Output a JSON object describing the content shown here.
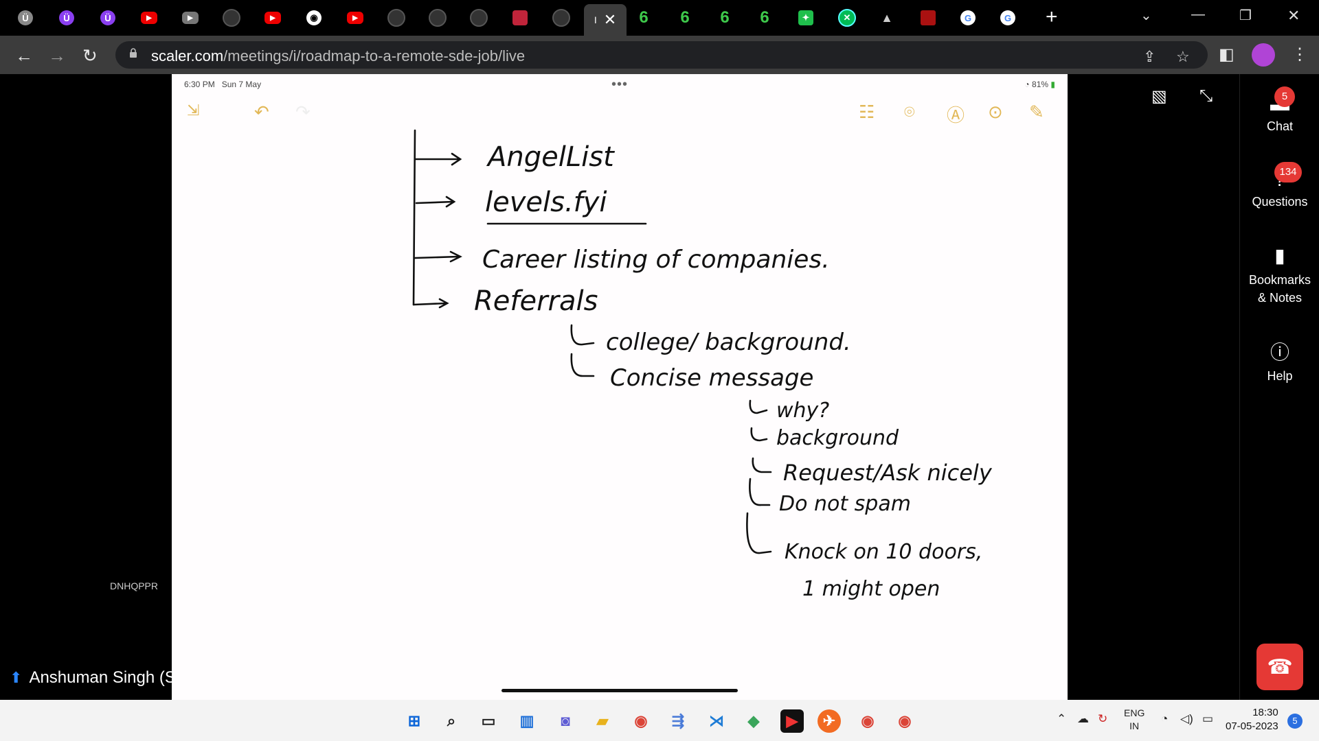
{
  "browser": {
    "active_tab_title": "I",
    "url_host": "scaler.com",
    "url_path": "/meetings/i/roadmap-to-a-remote-sde-job/live"
  },
  "ipad": {
    "time": "6:30 PM",
    "date": "Sun 7 May",
    "battery": "81%"
  },
  "notes": {
    "lines": [
      "AngelList",
      "levels.fyi",
      "Career listing of companies.",
      "Referrals",
      "college/ background.",
      "Concise message",
      "why?",
      "background",
      "Request/Ask nicely",
      "Do not spam",
      "Knock on 10 doors,",
      "1 might open"
    ]
  },
  "sidebar": {
    "chat_label": "Chat",
    "chat_badge": "5",
    "questions_label": "Questions",
    "questions_badge": "134",
    "bookmarks_label": "Bookmarks & Notes",
    "help_label": "Help"
  },
  "meeting": {
    "room_code": "DNHQPPR",
    "presenter": "Anshuman Singh (S"
  },
  "taskbar": {
    "lang_top": "ENG",
    "lang_bottom": "IN",
    "time": "18:30",
    "date": "07-05-2023",
    "notifications": "5"
  }
}
